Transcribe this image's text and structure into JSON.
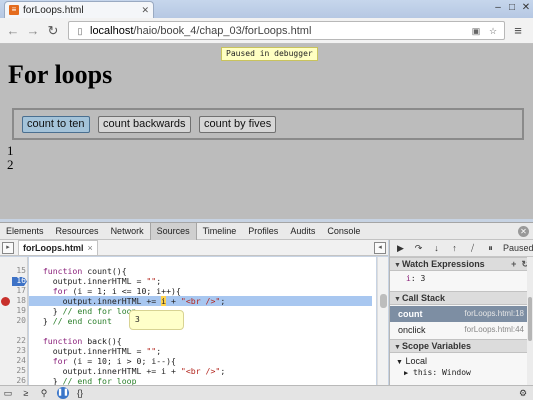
{
  "browser": {
    "tab_title": "forLoops.html",
    "url_host": "localhost",
    "url_path": "/haio/book_4/chap_03/forLoops.html"
  },
  "page": {
    "paused_label": "Paused in debugger",
    "heading": "For loops",
    "buttons": [
      "count to ten",
      "count backwards",
      "count by fives"
    ],
    "output_lines": [
      "1",
      "2"
    ]
  },
  "devtools": {
    "tabs": [
      "Elements",
      "Resources",
      "Network",
      "Sources",
      "Timeline",
      "Profiles",
      "Audits",
      "Console"
    ],
    "selected_tab": "Sources",
    "open_file": "forLoops.html",
    "line_numbers": [
      "15",
      "16",
      "17",
      "18",
      "19",
      "20",
      "",
      "22",
      "23",
      "24",
      "25",
      "26",
      "27"
    ],
    "tooltip_value": "3",
    "paused_status": "Paused",
    "watch_expressions": {
      "title": "Watch Expressions",
      "items": [
        {
          "name": "i",
          "value": "3"
        }
      ]
    },
    "call_stack": {
      "title": "Call Stack",
      "frames": [
        {
          "name": "count",
          "location": "forLoops.html:18"
        },
        {
          "name": "onclick",
          "location": "forLoops.html:44"
        }
      ]
    },
    "scope_variables": {
      "title": "Scope Variables",
      "local_label": "Local",
      "this_row": "this: Window"
    }
  }
}
